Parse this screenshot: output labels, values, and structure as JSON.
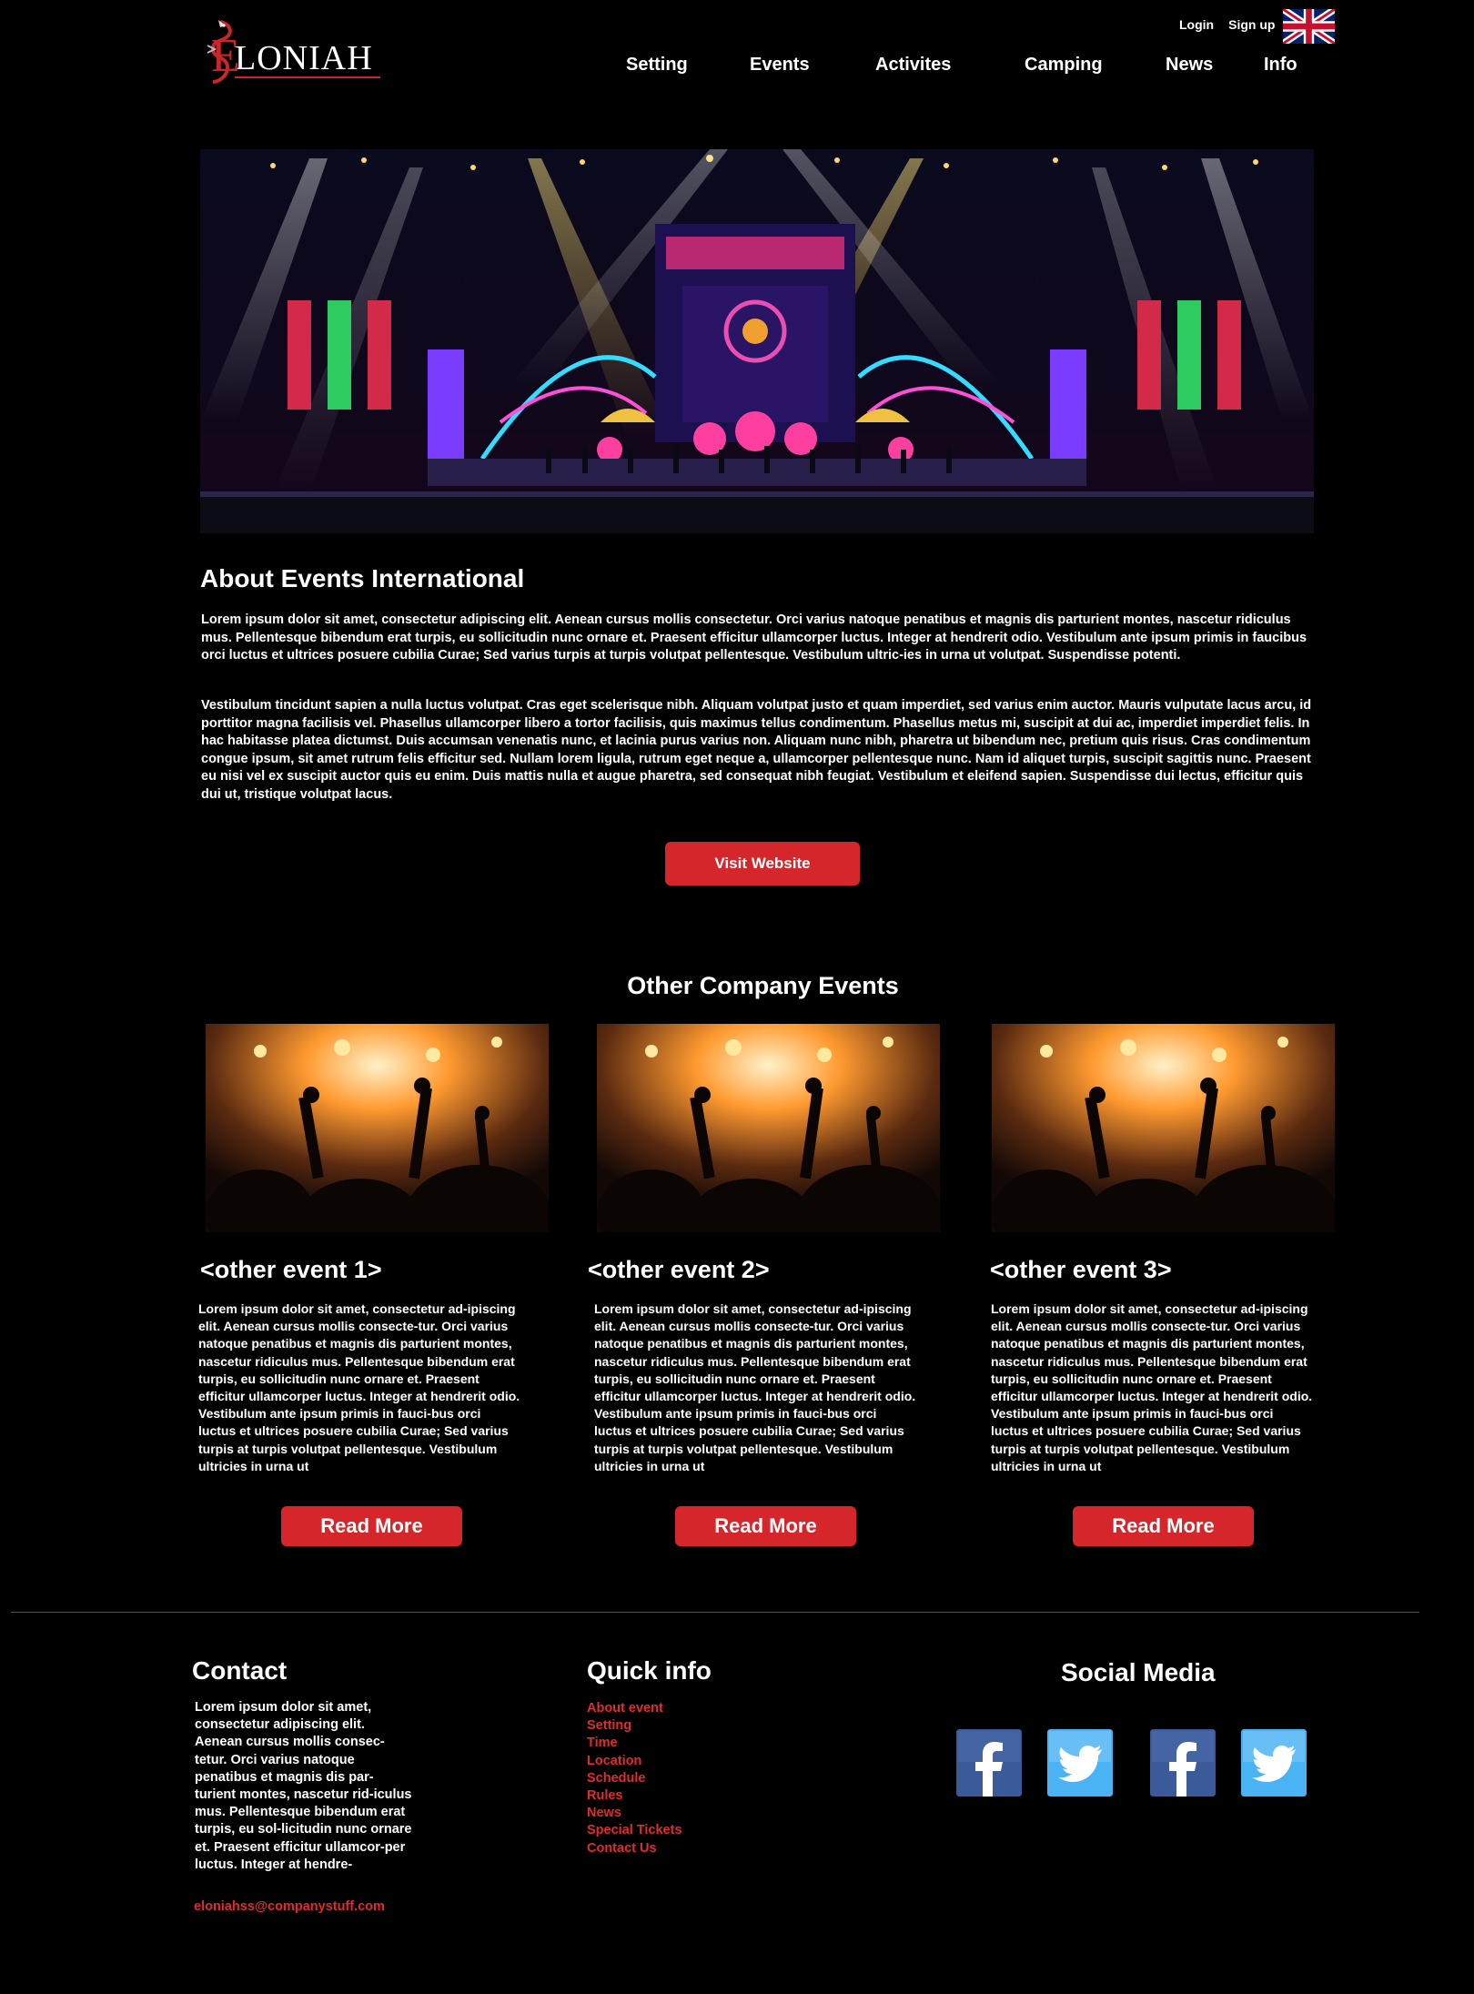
{
  "header": {
    "logo_text": "ELONIAH",
    "logo_initial": "E",
    "logo_rest": "LONIAH",
    "top_links": [
      "Login",
      "Sign up"
    ],
    "language_icon": "uk-flag-icon",
    "nav": [
      "Setting",
      "Events",
      "Activites",
      "Camping",
      "News",
      "Info"
    ]
  },
  "about": {
    "title": "About Events International",
    "paragraphs": [
      "Lorem ipsum dolor sit amet, consectetur adipiscing elit. Aenean cursus mollis consectetur. Orci varius natoque penatibus et magnis dis parturient montes, nascetur ridiculus mus. Pellentesque bibendum erat turpis, eu sollicitudin nunc ornare et. Praesent efficitur ullamcorper luctus. Integer at hendrerit odio. Vestibulum ante ipsum primis in faucibus orci luctus et ultrices posuere cubilia Curae; Sed varius turpis at turpis volutpat pellentesque. Vestibulum ultric-ies in urna ut volutpat. Suspendisse potenti.",
      "Vestibulum tincidunt sapien a nulla luctus volutpat. Cras eget scelerisque nibh. Aliquam volutpat justo et quam imperdiet, sed varius enim auctor. Mauris vulputate lacus arcu, id porttitor magna facilisis vel. Phasellus ullamcorper libero a tortor facilisis, quis maximus tellus condimentum. Phasellus metus mi, suscipit at dui ac, imperdiet imperdiet felis. In hac habitasse platea dictumst. Duis accumsan venenatis nunc, et lacinia purus varius non. Aliquam nunc nibh, pharetra ut bibendum nec, pretium quis risus. Cras condimentum congue ipsum, sit amet rutrum felis efficitur sed. Nullam lorem ligula, rutrum eget neque a, ullamcorper pellentesque nunc. Nam id aliquet turpis, suscipit sagittis nunc. Praesent eu nisi vel ex suscipit auctor quis eu enim. Duis mattis nulla et augue pharetra, sed consequat nibh feugiat. Vestibulum et eleifend sapien. Suspendisse dui lectus, efficitur quis dui ut, tristique volutpat lacus."
    ],
    "visit_button": "Visit Website"
  },
  "events": {
    "title": "Other Company Events",
    "items": [
      {
        "title": "<other event 1>",
        "text": "Lorem ipsum dolor sit amet, consectetur ad-ipiscing elit. Aenean cursus mollis consecte-tur. Orci varius natoque penatibus et magnis dis parturient montes, nascetur ridiculus mus. Pellentesque bibendum erat turpis, eu sollicitudin nunc ornare et. Praesent efficitur ullamcorper luctus. Integer at hendrerit odio. Vestibulum ante ipsum primis in fauci-bus orci luctus et ultrices posuere cubilia Curae; Sed varius turpis at turpis volutpat pellentesque. Vestibulum ultricies in urna ut",
        "button": "Read More"
      },
      {
        "title": "<other event 2>",
        "text": "Lorem ipsum dolor sit amet, consectetur ad-ipiscing elit. Aenean cursus mollis consecte-tur. Orci varius natoque penatibus et magnis dis parturient montes, nascetur ridiculus mus. Pellentesque bibendum erat turpis, eu sollicitudin nunc ornare et. Praesent efficitur ullamcorper luctus. Integer at hendrerit odio. Vestibulum ante ipsum primis in fauci-bus orci luctus et ultrices posuere cubilia Curae; Sed varius turpis at turpis volutpat pellentesque. Vestibulum ultricies in urna ut",
        "button": "Read More"
      },
      {
        "title": "<other event 3>",
        "text": "Lorem ipsum dolor sit amet, consectetur ad-ipiscing elit. Aenean cursus mollis consecte-tur. Orci varius natoque penatibus et magnis dis parturient montes, nascetur ridiculus mus. Pellentesque bibendum erat turpis, eu sollicitudin nunc ornare et. Praesent efficitur ullamcorper luctus. Integer at hendrerit odio. Vestibulum ante ipsum primis in fauci-bus orci luctus et ultrices posuere cubilia Curae; Sed varius turpis at turpis volutpat pellentesque. Vestibulum ultricies in urna ut",
        "button": "Read More"
      }
    ]
  },
  "footer": {
    "contact": {
      "title": "Contact",
      "text": "Lorem ipsum dolor sit amet, consectetur adipiscing elit. Aenean cursus mollis consec-tetur. Orci varius natoque penatibus et magnis dis par-turient montes, nascetur rid-iculus mus. Pellentesque bibendum erat turpis, eu sol-licitudin nunc ornare et. Praesent efficitur ullamcor-per luctus. Integer at hendre-",
      "email": "eloniahss@companystuff.com"
    },
    "quick_info": {
      "title": "Quick info",
      "links": [
        "About event",
        "Setting",
        "Time",
        "Location",
        "Schedule",
        "Rules",
        "News",
        "Special Tickets",
        "Contact Us"
      ]
    },
    "social": {
      "title": "Social Media",
      "icons": [
        "facebook-icon",
        "twitter-icon",
        "facebook-icon",
        "twitter-icon"
      ]
    }
  },
  "colors": {
    "background": "#000000",
    "accent_red": "#d4262b",
    "link_red": "#e02b2f",
    "facebook_blue": "#3b5a9a",
    "twitter_blue": "#4ab3f4"
  }
}
